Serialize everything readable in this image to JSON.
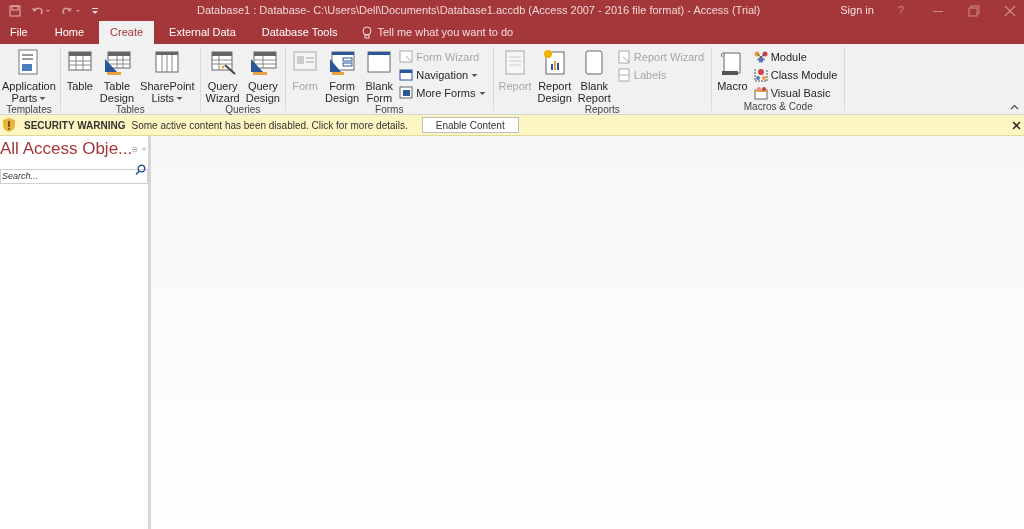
{
  "window": {
    "title": "Database1 : Database- C:\\Users\\Dell\\Documents\\Database1.accdb (Access 2007 - 2016 file format) - Access (Trial)",
    "sign_in": "Sign in",
    "help": "?"
  },
  "tabs": [
    {
      "label": "File",
      "selected": false,
      "kind": "file"
    },
    {
      "label": "Home",
      "selected": false,
      "kind": "tab"
    },
    {
      "label": "Create",
      "selected": true,
      "kind": "tab"
    },
    {
      "label": "External Data",
      "selected": false,
      "kind": "tab"
    },
    {
      "label": "Database Tools",
      "selected": false,
      "kind": "tab"
    }
  ],
  "tell_me": {
    "placeholder": "Tell me what you want to do"
  },
  "ribbon_groups": [
    {
      "label": "Templates",
      "buttons": [
        {
          "kind": "large",
          "lines": [
            "Application",
            "Parts"
          ],
          "dropdown": true,
          "disabled": false
        }
      ]
    },
    {
      "label": "Tables",
      "buttons": [
        {
          "kind": "large",
          "lines": [
            "Table"
          ],
          "dropdown": false,
          "disabled": false
        },
        {
          "kind": "large",
          "lines": [
            "Table",
            "Design"
          ],
          "dropdown": false,
          "disabled": false
        },
        {
          "kind": "large",
          "lines": [
            "SharePoint",
            "Lists"
          ],
          "dropdown": true,
          "disabled": false
        }
      ]
    },
    {
      "label": "Queries",
      "buttons": [
        {
          "kind": "large",
          "lines": [
            "Query",
            "Wizard"
          ],
          "dropdown": false,
          "disabled": false
        },
        {
          "kind": "large",
          "lines": [
            "Query",
            "Design"
          ],
          "dropdown": false,
          "disabled": false
        }
      ]
    },
    {
      "label": "Forms",
      "buttons": [
        {
          "kind": "large",
          "lines": [
            "Form"
          ],
          "dropdown": false,
          "disabled": true
        },
        {
          "kind": "large",
          "lines": [
            "Form",
            "Design"
          ],
          "dropdown": false,
          "disabled": false
        },
        {
          "kind": "large",
          "lines": [
            "Blank",
            "Form"
          ],
          "dropdown": false,
          "disabled": false
        },
        {
          "kind": "small",
          "lines": [
            "Form Wizard"
          ],
          "dropdown": false,
          "disabled": true
        },
        {
          "kind": "small",
          "lines": [
            "Navigation"
          ],
          "dropdown": true,
          "disabled": false
        },
        {
          "kind": "small",
          "lines": [
            "More Forms"
          ],
          "dropdown": true,
          "disabled": false
        }
      ]
    },
    {
      "label": "Reports",
      "buttons": [
        {
          "kind": "large",
          "lines": [
            "Report"
          ],
          "dropdown": false,
          "disabled": true
        },
        {
          "kind": "large",
          "lines": [
            "Report",
            "Design"
          ],
          "dropdown": false,
          "disabled": false
        },
        {
          "kind": "large",
          "lines": [
            "Blank",
            "Report"
          ],
          "dropdown": false,
          "disabled": false
        },
        {
          "kind": "small",
          "lines": [
            "Report Wizard"
          ],
          "dropdown": false,
          "disabled": true
        },
        {
          "kind": "small",
          "lines": [
            "Labels"
          ],
          "dropdown": false,
          "disabled": true
        }
      ]
    },
    {
      "label": "Macros & Code",
      "buttons": [
        {
          "kind": "large",
          "lines": [
            "Macro"
          ],
          "dropdown": false,
          "disabled": false
        },
        {
          "kind": "small",
          "lines": [
            "Module"
          ],
          "dropdown": false,
          "disabled": false
        },
        {
          "kind": "small",
          "lines": [
            "Class Module"
          ],
          "dropdown": false,
          "disabled": false
        },
        {
          "kind": "small",
          "lines": [
            "Visual Basic"
          ],
          "dropdown": false,
          "disabled": false
        }
      ]
    }
  ],
  "security_bar": {
    "title": "SECURITY WARNING",
    "message": "Some active content has been disabled. Click for more details.",
    "button": "Enable Content"
  },
  "nav_pane": {
    "title": "All Access Obje...",
    "search": {
      "placeholder": "Search..."
    }
  }
}
